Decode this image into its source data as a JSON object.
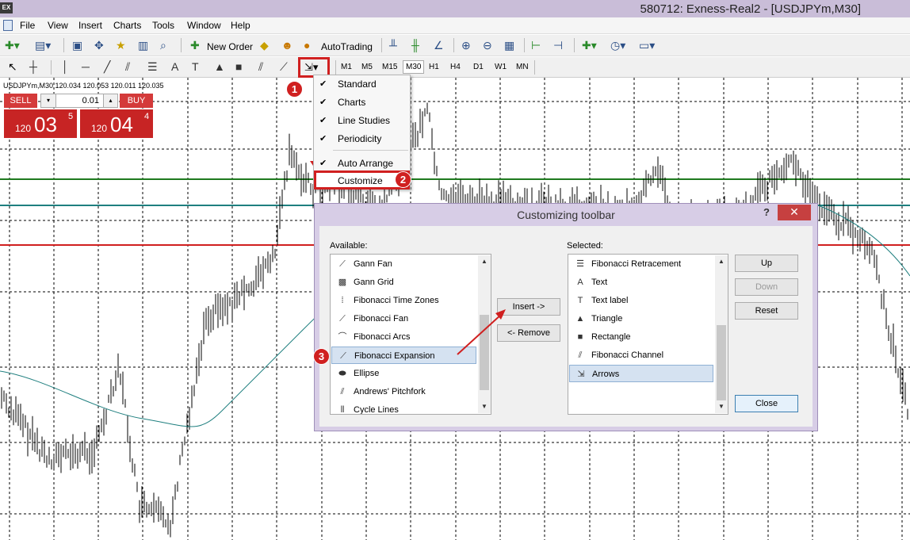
{
  "window": {
    "title": "580712: Exness-Real2 - [USDJPYm,M30]",
    "logo": "EX"
  },
  "menu": {
    "items": [
      "File",
      "View",
      "Insert",
      "Charts",
      "Tools",
      "Window",
      "Help"
    ]
  },
  "toolbar": {
    "new_order": "New Order",
    "autotrading": "AutoTrading"
  },
  "periods": [
    "M1",
    "M5",
    "M15",
    "M30",
    "H1",
    "H4",
    "D1",
    "W1",
    "MN"
  ],
  "active_period": "M30",
  "chart": {
    "info": "USDJPYm,M30  120.034  120.053  120.011  120.035",
    "sell_label": "SELL",
    "buy_label": "BUY",
    "lot": "0.01",
    "sell_price": {
      "prefix": "120",
      "big": "03",
      "sup": "5"
    },
    "buy_price": {
      "prefix": "120",
      "big": "04",
      "sup": "4"
    }
  },
  "dropdown": {
    "items": [
      {
        "label": "Standard",
        "checked": true
      },
      {
        "label": "Charts",
        "checked": true
      },
      {
        "label": "Line Studies",
        "checked": true
      },
      {
        "label": "Periodicity",
        "checked": true
      },
      {
        "label": "Auto Arrange",
        "checked": true
      },
      {
        "label": "Customize",
        "checked": false
      }
    ]
  },
  "dialog": {
    "title": "Customizing toolbar",
    "help": "?",
    "close_x": "✕",
    "available_label": "Available:",
    "selected_label": "Selected:",
    "available": [
      {
        "label": "Gann Fan",
        "icon": "gann-fan-icon"
      },
      {
        "label": "Gann Grid",
        "icon": "gann-grid-icon"
      },
      {
        "label": "Fibonacci Time Zones",
        "icon": "fib-time-zones-icon"
      },
      {
        "label": "Fibonacci Fan",
        "icon": "fib-fan-icon"
      },
      {
        "label": "Fibonacci Arcs",
        "icon": "fib-arcs-icon"
      },
      {
        "label": "Fibonacci Expansion",
        "icon": "fib-expansion-icon"
      },
      {
        "label": "Ellipse",
        "icon": "ellipse-icon"
      },
      {
        "label": "Andrews' Pitchfork",
        "icon": "pitchfork-icon"
      },
      {
        "label": "Cycle Lines",
        "icon": "cycle-lines-icon"
      }
    ],
    "available_selected": "Fibonacci Expansion",
    "selected": [
      {
        "label": "Fibonacci Retracement",
        "icon": "fib-retracement-icon"
      },
      {
        "label": "Text",
        "icon": "text-icon"
      },
      {
        "label": "Text label",
        "icon": "text-label-icon"
      },
      {
        "label": "Triangle",
        "icon": "triangle-icon"
      },
      {
        "label": "Rectangle",
        "icon": "rectangle-icon"
      },
      {
        "label": "Fibonacci Channel",
        "icon": "fib-channel-icon"
      },
      {
        "label": "Arrows",
        "icon": "arrows-icon"
      }
    ],
    "selected_selected": "Arrows",
    "insert": "Insert ->",
    "remove": "<- Remove",
    "up": "Up",
    "down": "Down",
    "reset": "Reset",
    "close": "Close"
  },
  "markers": [
    "1",
    "2",
    "3"
  ]
}
